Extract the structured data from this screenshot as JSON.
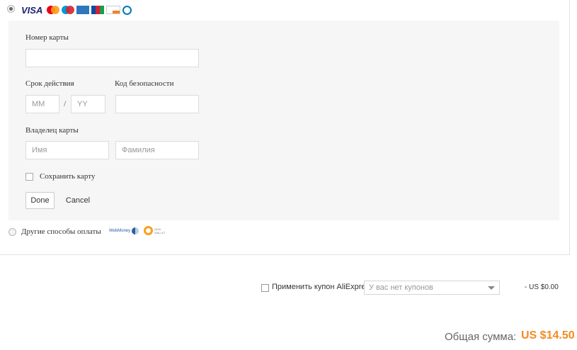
{
  "card_method": {
    "selected": true,
    "logos": [
      "visa",
      "mastercard",
      "maestro",
      "amex",
      "jcb",
      "discover",
      "diners-club"
    ],
    "visa_text": "VISA"
  },
  "form": {
    "card_number_label": "Номер карты",
    "card_number_value": "",
    "expiry_label": "Срок действия",
    "expiry_month_placeholder": "MM",
    "expiry_separator": "/",
    "expiry_year_placeholder": "YY",
    "cvc_label": "Код безопасности",
    "owner_label": "Владелец карты",
    "first_name_placeholder": "Имя",
    "last_name_placeholder": "Фамилия",
    "save_card_label": "Сохранить карту",
    "save_card_checked": false,
    "done_label": "Done",
    "cancel_label": "Cancel"
  },
  "other_methods": {
    "label": "Другие способы оплаты",
    "logos": [
      "webmoney",
      "qiwi-wallet"
    ]
  },
  "coupon": {
    "checkbox_label": "Применить купон AliExpress:",
    "checked": false,
    "select_value": "У вас нет купонов",
    "discount": "- US $0.00"
  },
  "total": {
    "label": "Общая сумма:",
    "value": "US $14.50"
  },
  "colors": {
    "accent": "#f28b21",
    "form_background": "#f6f6f6"
  }
}
